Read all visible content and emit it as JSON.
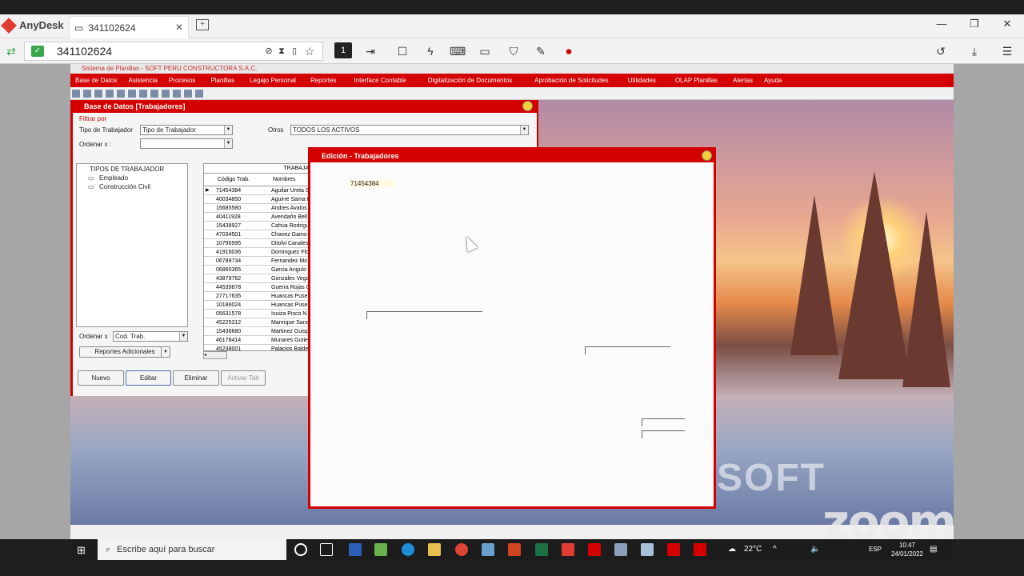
{
  "anydesk": {
    "brand": "AnyDesk",
    "tab_label": "341102624",
    "address": "341102624",
    "monitor_number": "1"
  },
  "app": {
    "title": "Sistema de Planillas - SOFT PERU CONSTRUCTORA S.A.C.",
    "menu": [
      "Base de Datos",
      "Asistencia",
      "Procesos",
      "Planillas",
      "Legajo Personal",
      "Reportes",
      "Interface Contable",
      "Digitalización de Documentos",
      "Aprobación de Solicitudes",
      "Utilidades",
      "OLAP Planillas",
      "Alertas",
      "Ayuda"
    ]
  },
  "base_datos": {
    "title": "Base de Datos [Trabajadores]",
    "filtro_label": "Filtrar por",
    "tipo_label": "Tipo de Trabajador",
    "tipo_value": "Tipo de Trabajador",
    "otros_label": "Otros",
    "otros_value": "TODOS LOS ACTIVOS",
    "ordenar_label": "Ordenar x :",
    "ordenar_value": "",
    "tree_root": "TIPOS DE TRABAJADOR",
    "tree_items": [
      "Empleado",
      "Construcción Civil"
    ],
    "ordenar2_label": "Ordenar x",
    "ordenar2_value": "Cod. Trab.",
    "reportes_label": "Reportes Adicionales",
    "grid_header": "TRABAJA",
    "col_codigo": "Código Trab.",
    "col_nombres": "Nombres",
    "rows": [
      {
        "codigo": "71454384",
        "nombre": "Aguilar Ureta S"
      },
      {
        "codigo": "40034850",
        "nombre": "Aguirre Sama E"
      },
      {
        "codigo": "15685580",
        "nombre": "Andres Avalos"
      },
      {
        "codigo": "40411928",
        "nombre": "Avendaño Bell"
      },
      {
        "codigo": "15438927",
        "nombre": "Cahua Rodrigu"
      },
      {
        "codigo": "47034501",
        "nombre": "Chavez Gamo I"
      },
      {
        "codigo": "10796995",
        "nombre": "Ditolvi Canales"
      },
      {
        "codigo": "41916036",
        "nombre": "Dominguez Flo"
      },
      {
        "codigo": "06789734",
        "nombre": "Fernandez Mo"
      },
      {
        "codigo": "06860365",
        "nombre": "Garcia Angulo"
      },
      {
        "codigo": "43879762",
        "nombre": "Gonzales Vega"
      },
      {
        "codigo": "44539878",
        "nombre": "Guerra Rojas G"
      },
      {
        "codigo": "27717635",
        "nombre": "Huancas Puse"
      },
      {
        "codigo": "10186024",
        "nombre": "Huancas Puse"
      },
      {
        "codigo": "05631578",
        "nombre": "Isuiza Pisco N"
      },
      {
        "codigo": "45225312",
        "nombre": "Manrique Sanc"
      },
      {
        "codigo": "15436680",
        "nombre": "Martinez Guisp"
      },
      {
        "codigo": "46178414",
        "nombre": "Munares Gutie"
      },
      {
        "codigo": "45238001",
        "nombre": "Palacios Balde"
      }
    ],
    "btn_nuevo": "Nuevo",
    "btn_editar": "Editar",
    "btn_eliminar": "Eliminar",
    "btn_activar": "Activar Tab"
  },
  "edicion": {
    "title": "Edición - Trabajadores",
    "codigo": "71454384"
  },
  "wallpaper_text": "SOFT",
  "taskbar": {
    "search_placeholder": "Escribe aquí para buscar",
    "temperature": "22°C",
    "language": "ESP",
    "time": "10:47",
    "date": "24/01/2022"
  },
  "zoom_watermark": "zoom",
  "colors": {
    "app_red": "#d40000",
    "anydesk_red": "#e03c31"
  }
}
